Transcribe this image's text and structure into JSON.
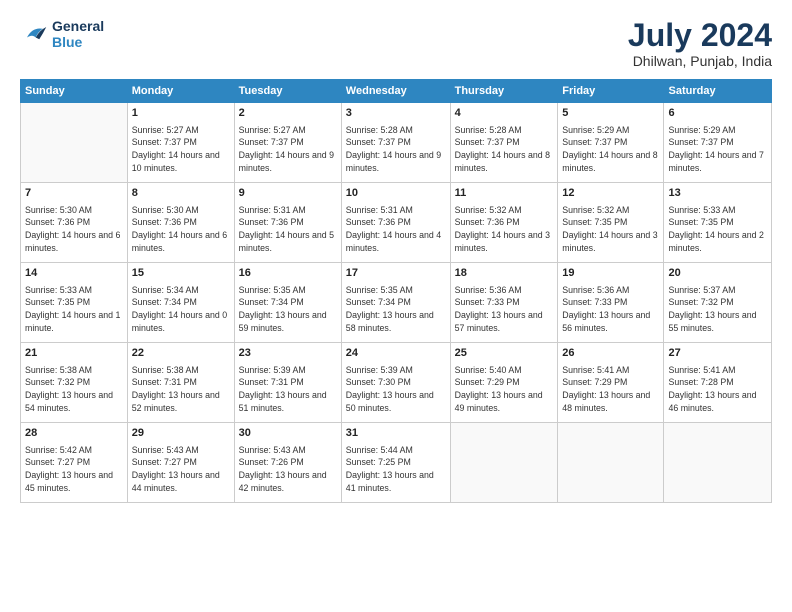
{
  "logo": {
    "line1": "General",
    "line2": "Blue"
  },
  "title": "July 2024",
  "subtitle": "Dhilwan, Punjab, India",
  "days_of_week": [
    "Sunday",
    "Monday",
    "Tuesday",
    "Wednesday",
    "Thursday",
    "Friday",
    "Saturday"
  ],
  "weeks": [
    [
      {
        "day": "",
        "sunrise": "",
        "sunset": "",
        "daylight": "",
        "empty": true
      },
      {
        "day": "1",
        "sunrise": "Sunrise: 5:27 AM",
        "sunset": "Sunset: 7:37 PM",
        "daylight": "Daylight: 14 hours and 10 minutes."
      },
      {
        "day": "2",
        "sunrise": "Sunrise: 5:27 AM",
        "sunset": "Sunset: 7:37 PM",
        "daylight": "Daylight: 14 hours and 9 minutes."
      },
      {
        "day": "3",
        "sunrise": "Sunrise: 5:28 AM",
        "sunset": "Sunset: 7:37 PM",
        "daylight": "Daylight: 14 hours and 9 minutes."
      },
      {
        "day": "4",
        "sunrise": "Sunrise: 5:28 AM",
        "sunset": "Sunset: 7:37 PM",
        "daylight": "Daylight: 14 hours and 8 minutes."
      },
      {
        "day": "5",
        "sunrise": "Sunrise: 5:29 AM",
        "sunset": "Sunset: 7:37 PM",
        "daylight": "Daylight: 14 hours and 8 minutes."
      },
      {
        "day": "6",
        "sunrise": "Sunrise: 5:29 AM",
        "sunset": "Sunset: 7:37 PM",
        "daylight": "Daylight: 14 hours and 7 minutes."
      }
    ],
    [
      {
        "day": "7",
        "sunrise": "Sunrise: 5:30 AM",
        "sunset": "Sunset: 7:36 PM",
        "daylight": "Daylight: 14 hours and 6 minutes."
      },
      {
        "day": "8",
        "sunrise": "Sunrise: 5:30 AM",
        "sunset": "Sunset: 7:36 PM",
        "daylight": "Daylight: 14 hours and 6 minutes."
      },
      {
        "day": "9",
        "sunrise": "Sunrise: 5:31 AM",
        "sunset": "Sunset: 7:36 PM",
        "daylight": "Daylight: 14 hours and 5 minutes."
      },
      {
        "day": "10",
        "sunrise": "Sunrise: 5:31 AM",
        "sunset": "Sunset: 7:36 PM",
        "daylight": "Daylight: 14 hours and 4 minutes."
      },
      {
        "day": "11",
        "sunrise": "Sunrise: 5:32 AM",
        "sunset": "Sunset: 7:36 PM",
        "daylight": "Daylight: 14 hours and 3 minutes."
      },
      {
        "day": "12",
        "sunrise": "Sunrise: 5:32 AM",
        "sunset": "Sunset: 7:35 PM",
        "daylight": "Daylight: 14 hours and 3 minutes."
      },
      {
        "day": "13",
        "sunrise": "Sunrise: 5:33 AM",
        "sunset": "Sunset: 7:35 PM",
        "daylight": "Daylight: 14 hours and 2 minutes."
      }
    ],
    [
      {
        "day": "14",
        "sunrise": "Sunrise: 5:33 AM",
        "sunset": "Sunset: 7:35 PM",
        "daylight": "Daylight: 14 hours and 1 minute."
      },
      {
        "day": "15",
        "sunrise": "Sunrise: 5:34 AM",
        "sunset": "Sunset: 7:34 PM",
        "daylight": "Daylight: 14 hours and 0 minutes."
      },
      {
        "day": "16",
        "sunrise": "Sunrise: 5:35 AM",
        "sunset": "Sunset: 7:34 PM",
        "daylight": "Daylight: 13 hours and 59 minutes."
      },
      {
        "day": "17",
        "sunrise": "Sunrise: 5:35 AM",
        "sunset": "Sunset: 7:34 PM",
        "daylight": "Daylight: 13 hours and 58 minutes."
      },
      {
        "day": "18",
        "sunrise": "Sunrise: 5:36 AM",
        "sunset": "Sunset: 7:33 PM",
        "daylight": "Daylight: 13 hours and 57 minutes."
      },
      {
        "day": "19",
        "sunrise": "Sunrise: 5:36 AM",
        "sunset": "Sunset: 7:33 PM",
        "daylight": "Daylight: 13 hours and 56 minutes."
      },
      {
        "day": "20",
        "sunrise": "Sunrise: 5:37 AM",
        "sunset": "Sunset: 7:32 PM",
        "daylight": "Daylight: 13 hours and 55 minutes."
      }
    ],
    [
      {
        "day": "21",
        "sunrise": "Sunrise: 5:38 AM",
        "sunset": "Sunset: 7:32 PM",
        "daylight": "Daylight: 13 hours and 54 minutes."
      },
      {
        "day": "22",
        "sunrise": "Sunrise: 5:38 AM",
        "sunset": "Sunset: 7:31 PM",
        "daylight": "Daylight: 13 hours and 52 minutes."
      },
      {
        "day": "23",
        "sunrise": "Sunrise: 5:39 AM",
        "sunset": "Sunset: 7:31 PM",
        "daylight": "Daylight: 13 hours and 51 minutes."
      },
      {
        "day": "24",
        "sunrise": "Sunrise: 5:39 AM",
        "sunset": "Sunset: 7:30 PM",
        "daylight": "Daylight: 13 hours and 50 minutes."
      },
      {
        "day": "25",
        "sunrise": "Sunrise: 5:40 AM",
        "sunset": "Sunset: 7:29 PM",
        "daylight": "Daylight: 13 hours and 49 minutes."
      },
      {
        "day": "26",
        "sunrise": "Sunrise: 5:41 AM",
        "sunset": "Sunset: 7:29 PM",
        "daylight": "Daylight: 13 hours and 48 minutes."
      },
      {
        "day": "27",
        "sunrise": "Sunrise: 5:41 AM",
        "sunset": "Sunset: 7:28 PM",
        "daylight": "Daylight: 13 hours and 46 minutes."
      }
    ],
    [
      {
        "day": "28",
        "sunrise": "Sunrise: 5:42 AM",
        "sunset": "Sunset: 7:27 PM",
        "daylight": "Daylight: 13 hours and 45 minutes."
      },
      {
        "day": "29",
        "sunrise": "Sunrise: 5:43 AM",
        "sunset": "Sunset: 7:27 PM",
        "daylight": "Daylight: 13 hours and 44 minutes."
      },
      {
        "day": "30",
        "sunrise": "Sunrise: 5:43 AM",
        "sunset": "Sunset: 7:26 PM",
        "daylight": "Daylight: 13 hours and 42 minutes."
      },
      {
        "day": "31",
        "sunrise": "Sunrise: 5:44 AM",
        "sunset": "Sunset: 7:25 PM",
        "daylight": "Daylight: 13 hours and 41 minutes."
      },
      {
        "day": "",
        "empty": true
      },
      {
        "day": "",
        "empty": true
      },
      {
        "day": "",
        "empty": true
      }
    ]
  ]
}
